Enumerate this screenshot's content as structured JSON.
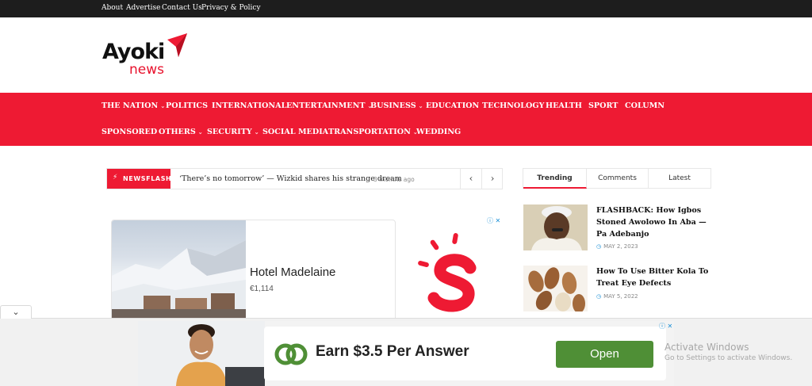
{
  "topbar": {
    "links": [
      "About",
      "Advertise",
      "Contact Us",
      "Privacy & Policy"
    ]
  },
  "brand": {
    "name": "Ayoki",
    "sub": "news",
    "accent_color": "#ee1a33"
  },
  "nav": {
    "row1": [
      {
        "label": "THE NATION",
        "dropdown": true
      },
      {
        "label": "POLITICS",
        "dropdown": false
      },
      {
        "label": "INTERNATIONAL",
        "dropdown": false
      },
      {
        "label": "ENTERTAINMENT",
        "dropdown": true
      },
      {
        "label": "BUSINESS",
        "dropdown": true
      },
      {
        "label": "EDUCATION",
        "dropdown": false
      },
      {
        "label": "TECHNOLOGY",
        "dropdown": false
      },
      {
        "label": "HEALTH",
        "dropdown": false
      },
      {
        "label": "SPORT",
        "dropdown": false
      },
      {
        "label": "COLUMN",
        "dropdown": false
      }
    ],
    "row2": [
      {
        "label": "SPONSORED",
        "dropdown": false
      },
      {
        "label": "OTHERS",
        "dropdown": true
      },
      {
        "label": "SECURITY",
        "dropdown": true
      },
      {
        "label": "SOCIAL MEDIA",
        "dropdown": false
      },
      {
        "label": "TRANSPORTATION",
        "dropdown": true
      },
      {
        "label": "WEDDING",
        "dropdown": false
      }
    ]
  },
  "newsflash": {
    "label": "NEWSFLASH",
    "headline": "‘There’s no tomorrow’ — Wizkid shares his strange dream",
    "time": "3 months ago",
    "prev_icon": "chevron-left-icon",
    "next_icon": "chevron-right-icon"
  },
  "ad_hotel": {
    "title": "Hotel Madelaine",
    "price": "€1,114"
  },
  "sidebar": {
    "tabs": [
      "Trending",
      "Comments",
      "Latest"
    ],
    "active_tab": "Trending",
    "posts": [
      {
        "title": "FLASHBACK: How Igbos Stoned Awolowo In Aba — Pa Adebanjo",
        "date": "MAY 2, 2023"
      },
      {
        "title": "How To Use Bitter Kola To Treat Eye Defects",
        "date": "MAY 5, 2022"
      }
    ]
  },
  "bottom_ad": {
    "headline": "Earn $3.5 Per Answer",
    "cta": "Open",
    "cta_color": "#4f8f36"
  },
  "watermark": {
    "title": "Activate Windows",
    "subtitle": "Go to Settings to activate Windows."
  }
}
